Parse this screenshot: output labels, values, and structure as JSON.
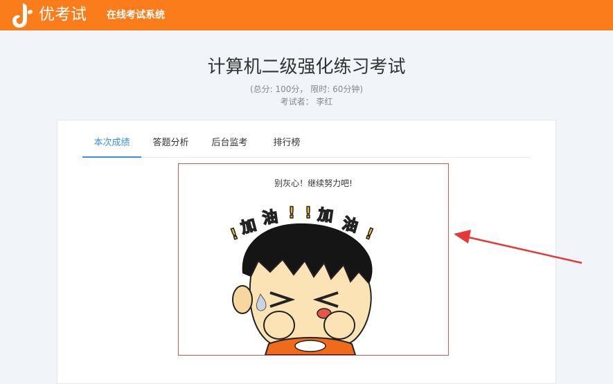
{
  "header": {
    "brand": "优考试",
    "system_name": "在线考试系统",
    "brand_color": "#fa7c1b"
  },
  "exam": {
    "title": "计算机二级强化练习考试",
    "meta": "(总分: 100分， 限时: 60分钟)",
    "taker": "考试者： 李红"
  },
  "tabs": [
    {
      "label": "本次成绩",
      "active": true
    },
    {
      "label": "答题分析",
      "active": false
    },
    {
      "label": "后台监考",
      "active": false
    },
    {
      "label": "排行榜",
      "active": false
    }
  ],
  "result": {
    "message": "别灰心！继续努力吧!",
    "cartoon_text": "!加油!!加油!"
  },
  "colors": {
    "accent": "#3a8ee6",
    "highlight_border": "#d9534f",
    "arrow": "#e53935"
  }
}
